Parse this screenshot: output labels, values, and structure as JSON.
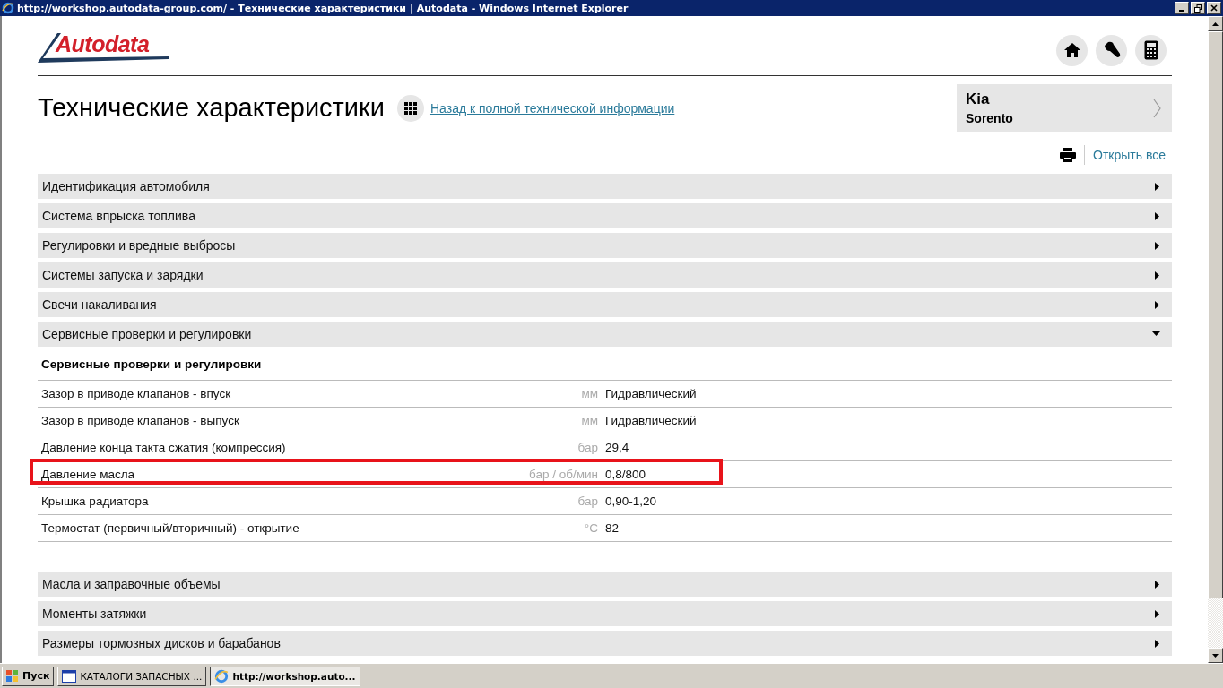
{
  "window": {
    "title": "http://workshop.autodata-group.com/ - Технические характеристики | Autodata - Windows Internet Explorer"
  },
  "logo": {
    "text": "Autodata"
  },
  "page": {
    "title": "Технические характеристики",
    "back_link": "Назад к полной технической информации",
    "open_all": "Открыть все"
  },
  "vehicle": {
    "make": "Kia",
    "model": "Sorento"
  },
  "sections": [
    {
      "label": "Идентификация автомобиля",
      "expanded": false
    },
    {
      "label": "Система впрыска топлива",
      "expanded": false
    },
    {
      "label": "Регулировки и вредные выбросы",
      "expanded": false
    },
    {
      "label": "Системы запуска и зарядки",
      "expanded": false
    },
    {
      "label": "Свечи накаливания",
      "expanded": false
    },
    {
      "label": "Сервисные проверки и регулировки",
      "expanded": true,
      "detail": {
        "heading": "Сервисные проверки и регулировки",
        "rows": [
          {
            "name": "Зазор в приводе клапанов - впуск",
            "unit": "мм",
            "value": "Гидравлический",
            "highlighted": false
          },
          {
            "name": "Зазор в приводе клапанов - выпуск",
            "unit": "мм",
            "value": "Гидравлический",
            "highlighted": false
          },
          {
            "name": "Давление конца такта сжатия (компрессия)",
            "unit": "бар",
            "value": "29,4",
            "highlighted": false
          },
          {
            "name": "Давление масла",
            "unit": "бар / об/мин",
            "value": "0,8/800",
            "highlighted": true
          },
          {
            "name": "Крышка радиатора",
            "unit": "бар",
            "value": "0,90-1,20",
            "highlighted": false
          },
          {
            "name": "Термостат (первичный/вторичный) - открытие",
            "unit": "°C",
            "value": "82",
            "highlighted": false
          }
        ]
      }
    },
    {
      "label": "Масла и заправочные объемы",
      "expanded": false
    },
    {
      "label": "Моменты затяжки",
      "expanded": false
    },
    {
      "label": "Размеры тормозных дисков и барабанов",
      "expanded": false
    }
  ],
  "taskbar": {
    "start": "Пуск",
    "tasks": [
      {
        "label": "КАТАЛОГИ ЗАПАСНЫХ ...",
        "selected": false
      },
      {
        "label": "http://workshop.auto...",
        "selected": true
      }
    ]
  }
}
